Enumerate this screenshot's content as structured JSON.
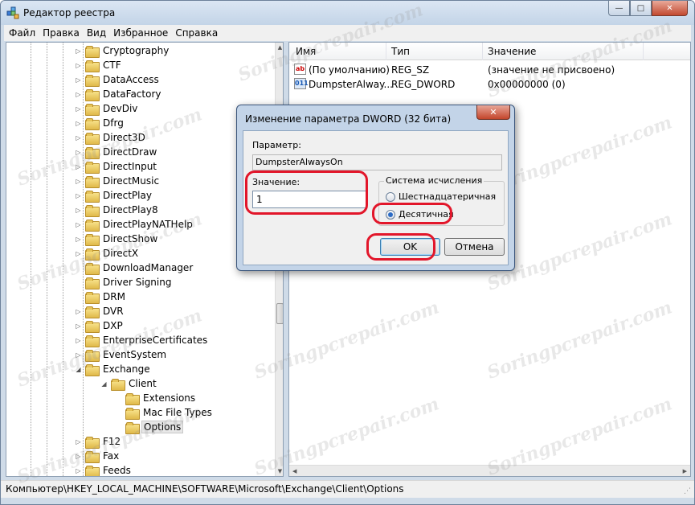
{
  "window": {
    "title": "Редактор реестра",
    "buttons": {
      "minimize": "—",
      "maximize": "□",
      "close": "✕"
    }
  },
  "menu": [
    "Файл",
    "Правка",
    "Вид",
    "Избранное",
    "Справка"
  ],
  "tree": {
    "items": [
      {
        "label": "Cryptography",
        "level": 0,
        "expander": "▷"
      },
      {
        "label": "CTF",
        "level": 0,
        "expander": "▷"
      },
      {
        "label": "DataAccess",
        "level": 0,
        "expander": "▷"
      },
      {
        "label": "DataFactory",
        "level": 0,
        "expander": "▷"
      },
      {
        "label": "DevDiv",
        "level": 0,
        "expander": "▷"
      },
      {
        "label": "Dfrg",
        "level": 0,
        "expander": "▷"
      },
      {
        "label": "Direct3D",
        "level": 0,
        "expander": "▷"
      },
      {
        "label": "DirectDraw",
        "level": 0,
        "expander": "▷"
      },
      {
        "label": "DirectInput",
        "level": 0,
        "expander": "▷"
      },
      {
        "label": "DirectMusic",
        "level": 0,
        "expander": "▷"
      },
      {
        "label": "DirectPlay",
        "level": 0,
        "expander": "▷"
      },
      {
        "label": "DirectPlay8",
        "level": 0,
        "expander": "▷"
      },
      {
        "label": "DirectPlayNATHelp",
        "level": 0,
        "expander": "▷"
      },
      {
        "label": "DirectShow",
        "level": 0,
        "expander": "▷"
      },
      {
        "label": "DirectX",
        "level": 0,
        "expander": "▷"
      },
      {
        "label": "DownloadManager",
        "level": 0,
        "expander": ""
      },
      {
        "label": "Driver Signing",
        "level": 0,
        "expander": ""
      },
      {
        "label": "DRM",
        "level": 0,
        "expander": ""
      },
      {
        "label": "DVR",
        "level": 0,
        "expander": "▷"
      },
      {
        "label": "DXP",
        "level": 0,
        "expander": "▷"
      },
      {
        "label": "EnterpriseCertificates",
        "level": 0,
        "expander": "▷"
      },
      {
        "label": "EventSystem",
        "level": 0,
        "expander": "▷"
      },
      {
        "label": "Exchange",
        "level": 0,
        "expander": "◢"
      },
      {
        "label": "Client",
        "level": 1,
        "expander": "◢"
      },
      {
        "label": "Extensions",
        "level": 2,
        "expander": ""
      },
      {
        "label": "Mac File Types",
        "level": 2,
        "expander": ""
      },
      {
        "label": "Options",
        "level": 2,
        "expander": "",
        "selected": true
      },
      {
        "label": "F12",
        "level": 0,
        "expander": "▷"
      },
      {
        "label": "Fax",
        "level": 0,
        "expander": "▷"
      },
      {
        "label": "Feeds",
        "level": 0,
        "expander": "▷"
      }
    ]
  },
  "list": {
    "columns": [
      "Имя",
      "Тип",
      "Значение"
    ],
    "rows": [
      {
        "icon": "ab",
        "name": "(По умолчанию)",
        "type": "REG_SZ",
        "value": "(значение не присвоено)"
      },
      {
        "icon": "011",
        "name": "DumpsterAlway...",
        "type": "REG_DWORD",
        "value": "0x00000000 (0)"
      }
    ]
  },
  "status": {
    "path": "Компьютер\\HKEY_LOCAL_MACHINE\\SOFTWARE\\Microsoft\\Exchange\\Client\\Options"
  },
  "watermark": "Soringpcrepair.com",
  "dialog": {
    "title": "Изменение параметра DWORD (32 бита)",
    "close": "✕",
    "param_label": "Параметр:",
    "param_value": "DumpsterAlwaysOn",
    "value_label": "Значение:",
    "value": "1",
    "base_label": "Система исчисления",
    "radio_hex": "Шестнадцатеричная",
    "radio_dec": "Десятичная",
    "selected_base": "dec",
    "ok": "OK",
    "cancel": "Отмена"
  },
  "colors": {
    "highlight": "#e2162a",
    "selection": "#e7e7e7"
  }
}
